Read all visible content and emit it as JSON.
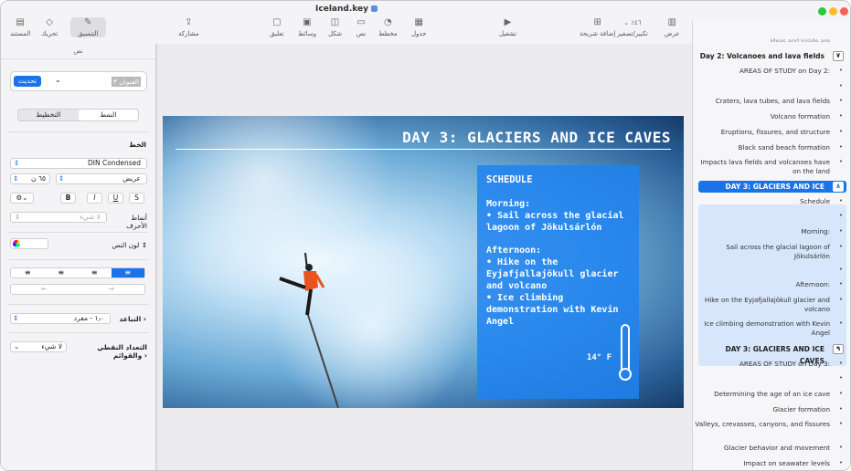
{
  "window": {
    "title": "Iceland.key"
  },
  "toolbar": {
    "view": "عرض",
    "zoom": "٪٤٦",
    "zoom_label": "تكبير/تصغير",
    "add_slide": "إضافة شريحة",
    "play": "تشغيل",
    "table": "جدول",
    "chart": "مخطط",
    "text": "نص",
    "shape": "شكل",
    "media": "وسائط",
    "comment": "تعليق",
    "share": "مشاركة",
    "format": "التنسيق",
    "animate": "تحريك",
    "document": "المستند"
  },
  "inspector": {
    "tab": "نص",
    "style_name": "العنوان ٣",
    "update": "تحديث",
    "tab_style": "النمط",
    "tab_layout": "التخطيط",
    "font_section": "الخط",
    "font_name": "DIN Condensed",
    "font_weight": "عريض",
    "font_size": "٦٥ ن",
    "char_styles_label": "أنماط الأحرف",
    "char_styles_value": "لا شيء",
    "text_color_label": "لون النص",
    "spacing_label": "التباعد",
    "spacing_value": "١٫٠ - مفرد",
    "bullets_label": "التعداد النقطي والقوائم",
    "bullets_value": "لا شيء",
    "bold": "B",
    "italic": "I",
    "underline": "U",
    "strike": "S"
  },
  "slide": {
    "title": "DAY 3: GLACIERS AND ICE CAVES",
    "schedule_heading": "SCHEDULE",
    "morning": "Morning:",
    "morning_item": "• Sail across the glacial lagoon of Jökulsárlón",
    "afternoon": "Afternoon:",
    "afternoon_item1": "• Hike on the Eyjafjallajökull glacier and volcano",
    "afternoon_item2": "• Ice climbing demonstration with Kevin Angel",
    "temperature": "14° F"
  },
  "outline": {
    "cut_top": "Ideas and inside are",
    "day2": {
      "num": "٧",
      "title": "Day 2: Volcanoes and lava fields",
      "items": [
        "AREAS OF STUDY on Day 2:",
        "",
        "Craters, lava tubes, and lava fields",
        "Volcano formation",
        "Eruptions, fissures, and structure",
        "Black sand beach formation",
        "Impacts lava fields and volcanoes have on the land"
      ]
    },
    "day3a": {
      "num": "٨",
      "title": "DAY 3: GLACIERS AND ICE CAVES",
      "items": [
        "Schedule",
        "",
        "Morning:",
        "Sail across the glacial lagoon of Jökulsárlón",
        "",
        "Afternoon:",
        "Hike on the Eyjafjallajökull glacier and volcano",
        "Ice climbing demonstration with Kevin Angel"
      ]
    },
    "day3b": {
      "num": "٩",
      "title": "DAY 3: GLACIERS AND ICE CAVES",
      "items": [
        "AREAS OF STUDY on Day 3:",
        "",
        "Determining the age of an ice cave",
        "Glacier formation",
        "Valleys, crevasses, canyons, and fissures",
        "Glacier behavior and movement",
        "Impact on seawater levels"
      ]
    }
  }
}
